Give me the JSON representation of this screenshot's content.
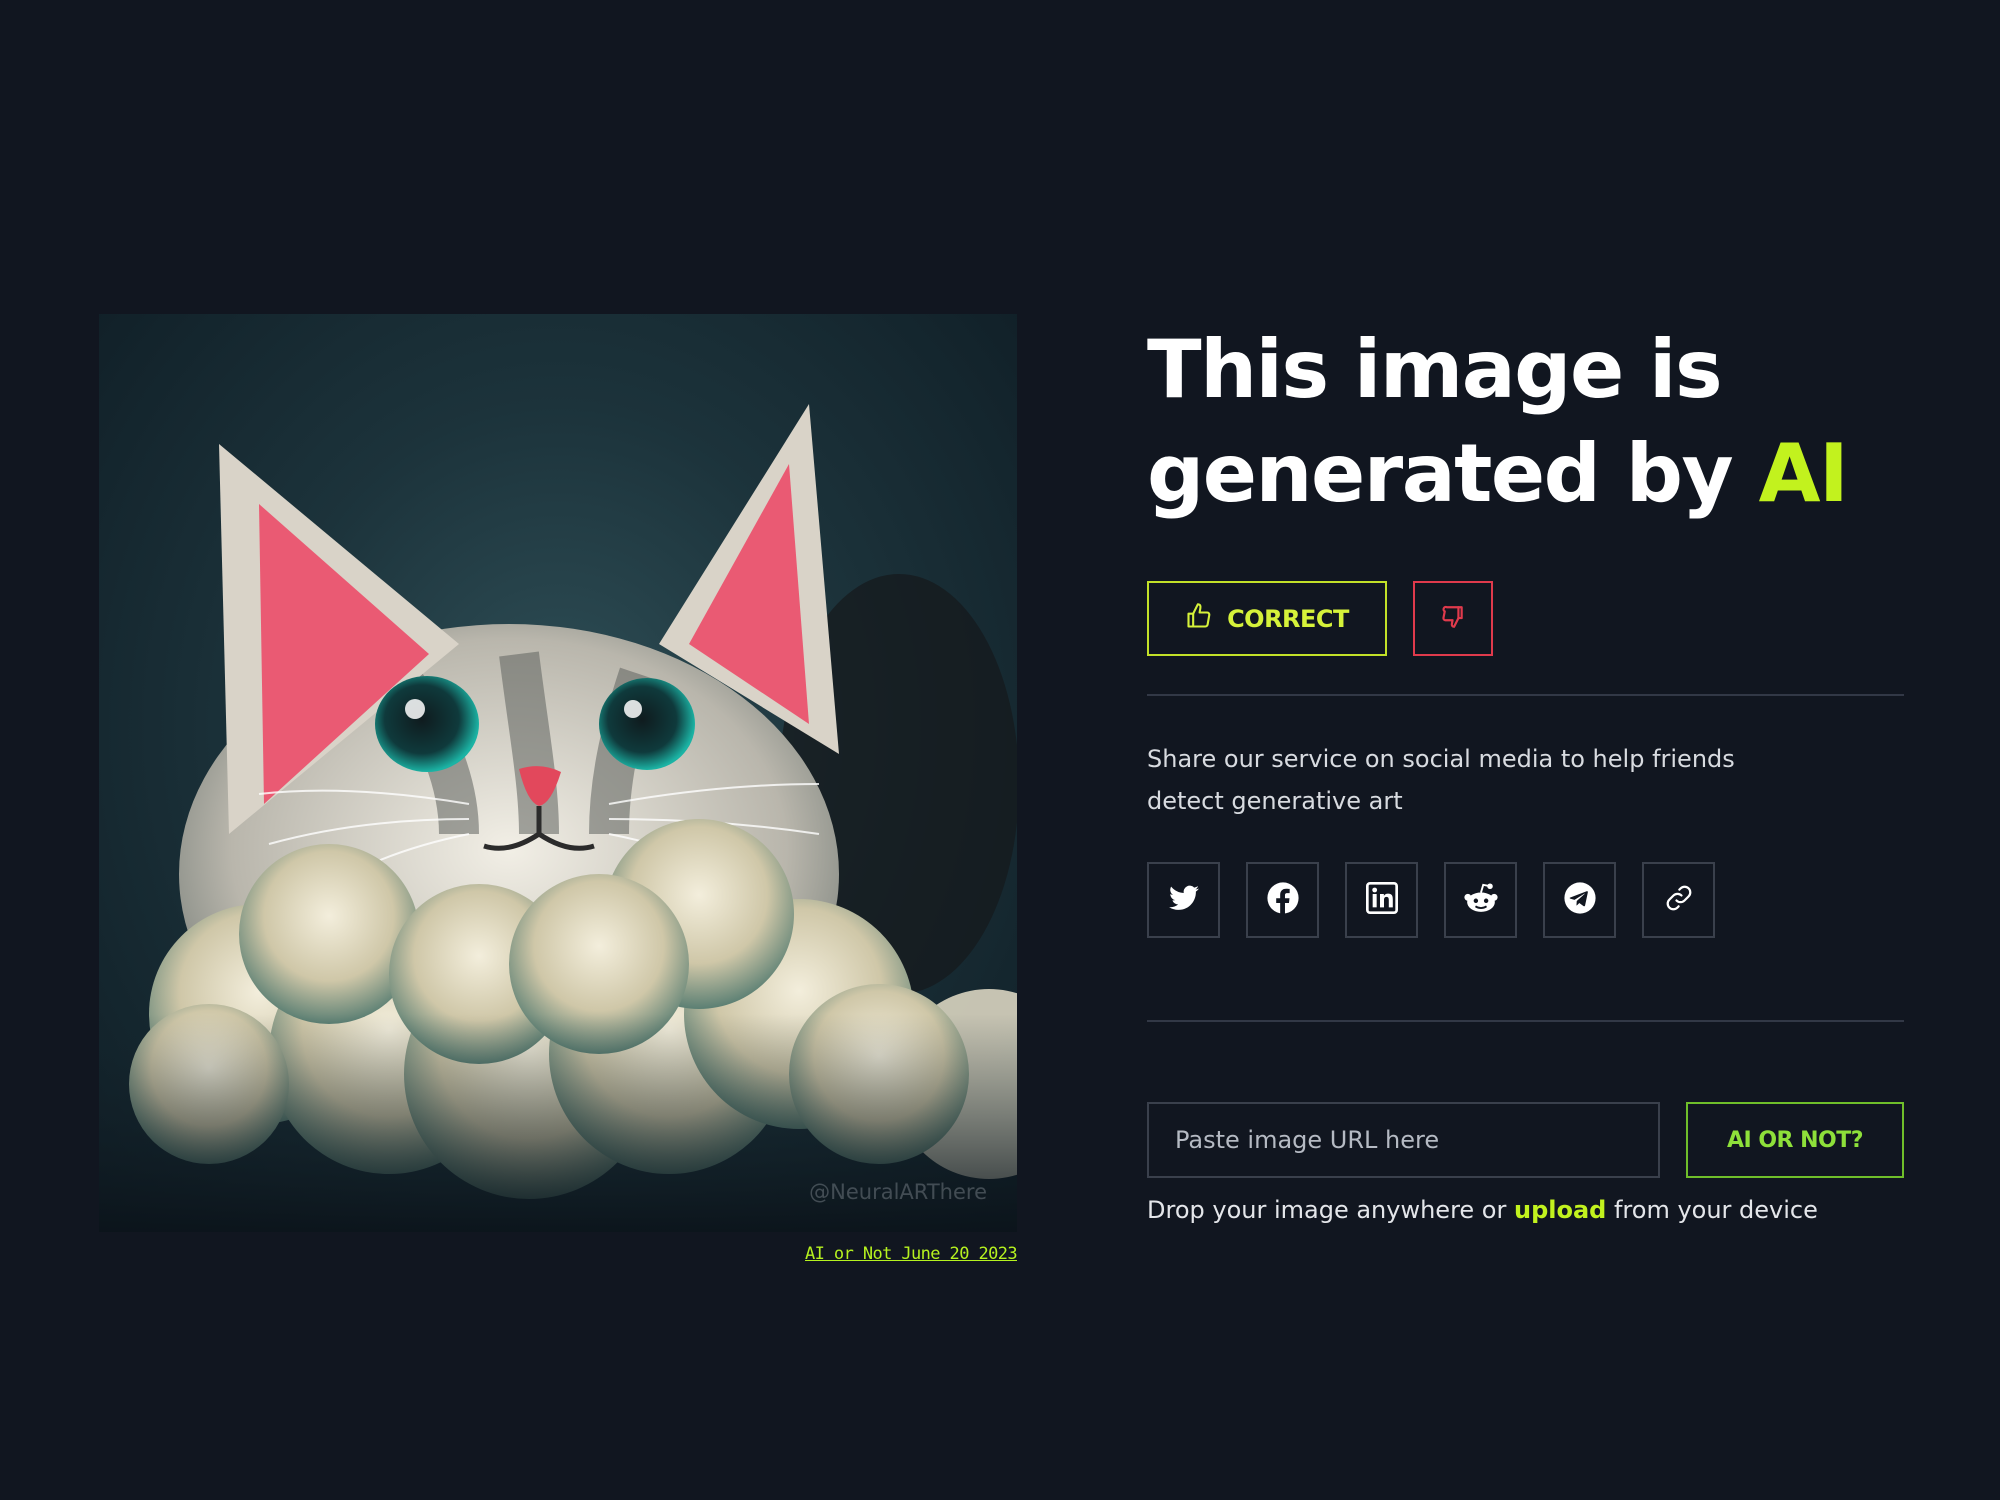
{
  "image": {
    "watermark": "@NeuralARThere",
    "caption": "AI or Not June 20 2023"
  },
  "result": {
    "headline_prefix": "This image is generated by ",
    "headline_accent": "AI"
  },
  "feedback": {
    "correct_label": "CORRECT",
    "correct_icon": "thumbs-up-icon",
    "wrong_icon": "thumbs-down-icon"
  },
  "share": {
    "text": "Share our service on social media to help friends detect generative art",
    "buttons": [
      {
        "id": "twitter",
        "icon": "twitter-icon"
      },
      {
        "id": "facebook",
        "icon": "facebook-icon"
      },
      {
        "id": "linkedin",
        "icon": "linkedin-icon"
      },
      {
        "id": "reddit",
        "icon": "reddit-icon"
      },
      {
        "id": "telegram",
        "icon": "telegram-icon"
      },
      {
        "id": "copy-link",
        "icon": "link-icon"
      }
    ]
  },
  "check": {
    "placeholder": "Paste image URL here",
    "value": "",
    "button_label": "AI OR NOT?",
    "drop_prefix": "Drop your image anywhere or ",
    "drop_link": "upload",
    "drop_suffix": " from your device"
  },
  "colors": {
    "background": "#111620",
    "accent": "#c2f21e",
    "correct_border": "#c2e028",
    "wrong_border": "#e03a4c",
    "check_border": "#6fbe2a"
  }
}
